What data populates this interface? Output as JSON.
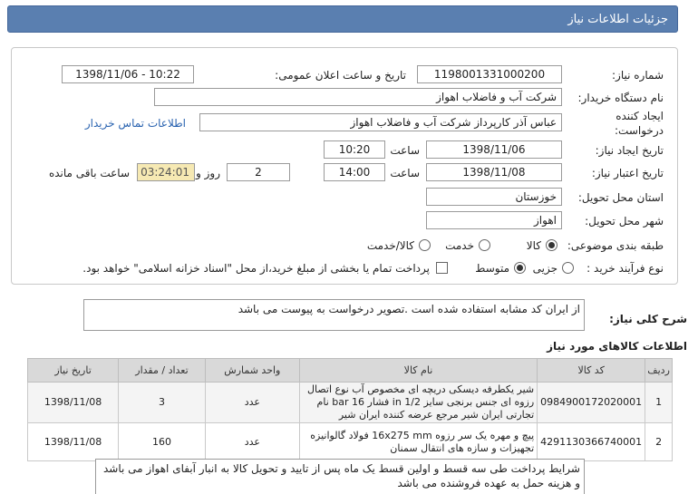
{
  "header": {
    "title": "جزئیات اطلاعات نیاز"
  },
  "form": {
    "need_number_label": "شماره نیاز:",
    "need_number": "1198001331000200",
    "announce_label": "تاریخ و ساعت اعلان عمومی:",
    "announce_value": "1398/11/06 - 10:22",
    "buyer_org_label": "نام دستگاه خریدار:",
    "buyer_org": "شرکت آب و فاضلاب اهواز",
    "requester_label_1": "ایجاد کننده",
    "requester_label_2": "درخواست:",
    "requester": "عباس آذر کارپرداز شرکت آب و فاضلاب اهواز",
    "contact_link": "اطلاعات تماس خریدار",
    "created_label": "تاریخ ایجاد نیاز:",
    "created_date": "1398/11/06",
    "created_time_label": "ساعت",
    "created_time": "10:20",
    "valid_label": "تاریخ اعتبار نیاز:",
    "valid_date": "1398/11/08",
    "valid_time_label": "ساعت",
    "valid_time": "14:00",
    "days": "2",
    "days_label": "روز و",
    "remaining": "03:24:01",
    "remaining_label": "ساعت باقی مانده",
    "province_label": "استان محل تحویل:",
    "province": "خوزستان",
    "city_label": "شهر محل تحویل:",
    "city": "اهواز",
    "category_label": "طبقه بندی موضوعی:",
    "category_options": [
      "کالا",
      "خدمت",
      "کالا/خدمت"
    ],
    "process_label": "نوع فرآیند خرید :",
    "process_options": [
      "جزیی",
      "متوسط"
    ],
    "payment_note": "پرداخت تمام یا بخشی از مبلغ خرید،از محل \"اسناد خزانه اسلامی\" خواهد بود."
  },
  "description": {
    "label": "شرح کلی نیاز:",
    "text": "از ایران کد مشابه استفاده شده است .تصویر درخواست به پیوست می باشد"
  },
  "items_section": {
    "title": "اطلاعات کالاهای مورد نیاز",
    "columns": [
      "ردیف",
      "کد کالا",
      "نام کالا",
      "واحد شمارش",
      "تعداد / مقدار",
      "تاریخ نیاز"
    ],
    "rows": [
      {
        "row": "1",
        "code": "0984900172020001",
        "name": "شیر یکطرفه دیسکی دریچه ای مخصوص آب نوع اتصال رزوه ای جنس برنجی سایز 1/2 in فشار 16 bar نام تجارتی ایران شیر مرجع عرضه کننده ایران شیر",
        "unit": "عدد",
        "qty": "3",
        "date": "1398/11/08"
      },
      {
        "row": "2",
        "code": "4291130366740001",
        "name": "پیچ و مهره یک سر رزوه 16x275 mm فولاد گالوانیزه تجهیزات و سازه های انتقال سمنان",
        "unit": "عدد",
        "qty": "160",
        "date": "1398/11/08"
      }
    ]
  },
  "footer_note": "شرایط پرداخت طی سه قسط و اولین قسط یک ماه پس از تایید و تحویل کالا به انبار آبفای اهواز می باشد و هزینه حمل به عهده فروشنده می باشد"
}
